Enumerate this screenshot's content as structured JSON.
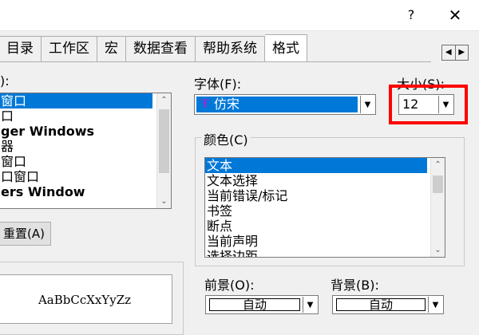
{
  "window": {
    "help_label": "?",
    "close_label": "✕"
  },
  "tabs": [
    {
      "label": "目录"
    },
    {
      "label": "工作区"
    },
    {
      "label": "宏"
    },
    {
      "label": "数据查看"
    },
    {
      "label": "帮助系统"
    },
    {
      "label": "格式"
    }
  ],
  "tab_scroll": {
    "left": "◀",
    "right": "▶"
  },
  "category": {
    "label_suffix": "):",
    "items": [
      {
        "label": "窗口",
        "selected": true
      },
      {
        "label": "口"
      },
      {
        "label": "ger Windows"
      },
      {
        "label": "器"
      },
      {
        "label": "窗口"
      },
      {
        "label": "口窗口"
      },
      {
        "label": "ers Window"
      }
    ],
    "reset_button_label": "重置(A)"
  },
  "font": {
    "label": "字体(F):",
    "value": "仿宋",
    "icon": "truetype-icon"
  },
  "size": {
    "label": "大小(S):",
    "value": "12"
  },
  "color": {
    "label": "颜色(C)",
    "items": [
      {
        "label": "文本",
        "selected": true
      },
      {
        "label": "文本选择"
      },
      {
        "label": "当前错误/标记"
      },
      {
        "label": "书签"
      },
      {
        "label": "断点"
      },
      {
        "label": "当前声明"
      },
      {
        "label": "选择边距"
      }
    ]
  },
  "foreground": {
    "label": "前景(O):",
    "value": "自动"
  },
  "background": {
    "label": "背景(B):",
    "value": "自动"
  },
  "sample": {
    "text": "AaBbCcXxYyZz"
  },
  "highlight_color": "#ff0000",
  "selection_color": "#0078d7"
}
